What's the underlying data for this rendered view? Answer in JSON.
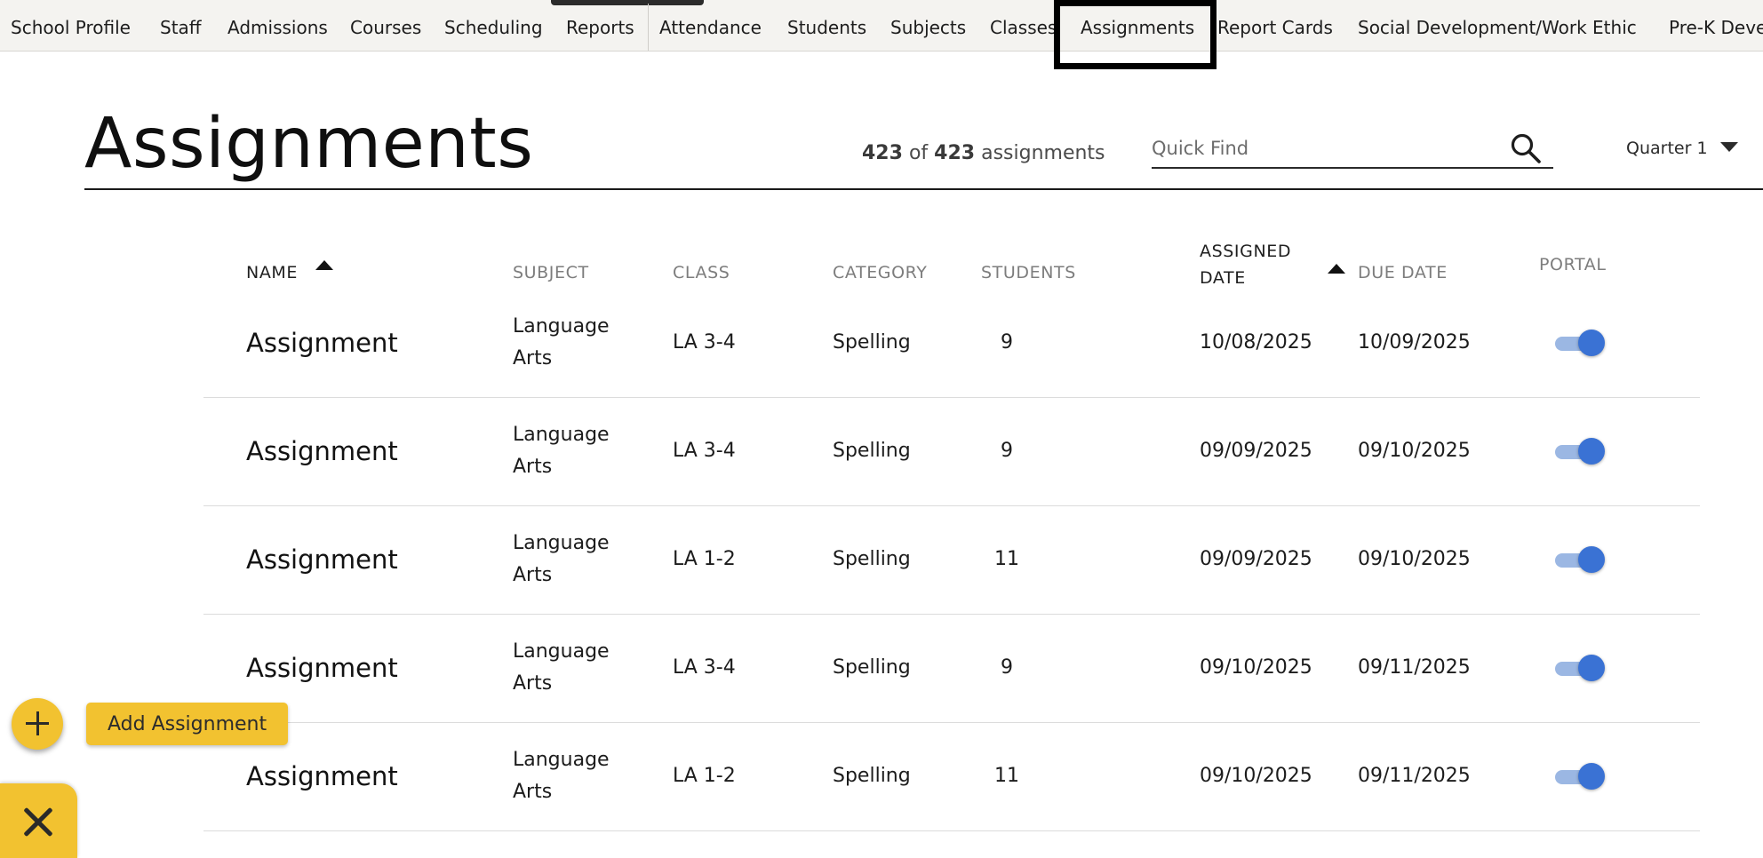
{
  "nav": {
    "items": [
      {
        "label": "School Profile"
      },
      {
        "label": "Staff"
      },
      {
        "label": "Admissions"
      },
      {
        "label": "Courses"
      },
      {
        "label": "Scheduling"
      },
      {
        "label": "Reports"
      },
      {
        "label": "Attendance"
      },
      {
        "label": "Students"
      },
      {
        "label": "Subjects"
      },
      {
        "label": "Classes"
      },
      {
        "label": "Assignments",
        "active": true
      },
      {
        "label": "Report Cards"
      },
      {
        "label": "Social Development/Work Ethic"
      },
      {
        "label": "Pre-K Deve"
      }
    ]
  },
  "header": {
    "title": "Assignments",
    "count_shown": "423",
    "count_of": "of",
    "count_total": "423",
    "count_suffix": "assignments",
    "search_placeholder": "Quick Find",
    "quarter": "Quarter 1"
  },
  "table": {
    "columns": {
      "name": "NAME",
      "subject": "SUBJECT",
      "class": "CLASS",
      "category": "CATEGORY",
      "students": "STUDENTS",
      "assigned_line1": "ASSIGNED",
      "assigned_line2": "DATE",
      "due": "DUE DATE",
      "portal": "PORTAL"
    },
    "rows": [
      {
        "name": "Assignment",
        "subject_line1": "Language",
        "subject_line2": "Arts",
        "class": "LA 3-4",
        "category": "Spelling",
        "students": "9",
        "assigned": "10/08/2025",
        "due": "10/09/2025",
        "portal": true
      },
      {
        "name": "Assignment",
        "subject_line1": "Language",
        "subject_line2": "Arts",
        "class": "LA 3-4",
        "category": "Spelling",
        "students": "9",
        "assigned": "09/09/2025",
        "due": "09/10/2025",
        "portal": true
      },
      {
        "name": "Assignment",
        "subject_line1": "Language",
        "subject_line2": "Arts",
        "class": "LA 1-2",
        "category": "Spelling",
        "students": "11",
        "assigned": "09/09/2025",
        "due": "09/10/2025",
        "portal": true
      },
      {
        "name": "Assignment",
        "subject_line1": "Language",
        "subject_line2": "Arts",
        "class": "LA 3-4",
        "category": "Spelling",
        "students": "9",
        "assigned": "09/10/2025",
        "due": "09/11/2025",
        "portal": true
      },
      {
        "name": "Assignment",
        "subject_line1": "Language",
        "subject_line2": "Arts",
        "class": "LA 1-2",
        "category": "Spelling",
        "students": "11",
        "assigned": "09/10/2025",
        "due": "09/11/2025",
        "portal": true
      }
    ]
  },
  "actions": {
    "add_label": "Add Assignment"
  },
  "colors": {
    "accent": "#f2c230",
    "toggle_on": "#3a72d4",
    "toggle_track": "#9bb7e3",
    "nav_bg": "#f4f3f0"
  },
  "icons": {
    "search": "search-icon",
    "add": "plus-icon",
    "close": "close-icon",
    "caret": "caret-down-icon",
    "sort": "sort-ascending-icon"
  }
}
